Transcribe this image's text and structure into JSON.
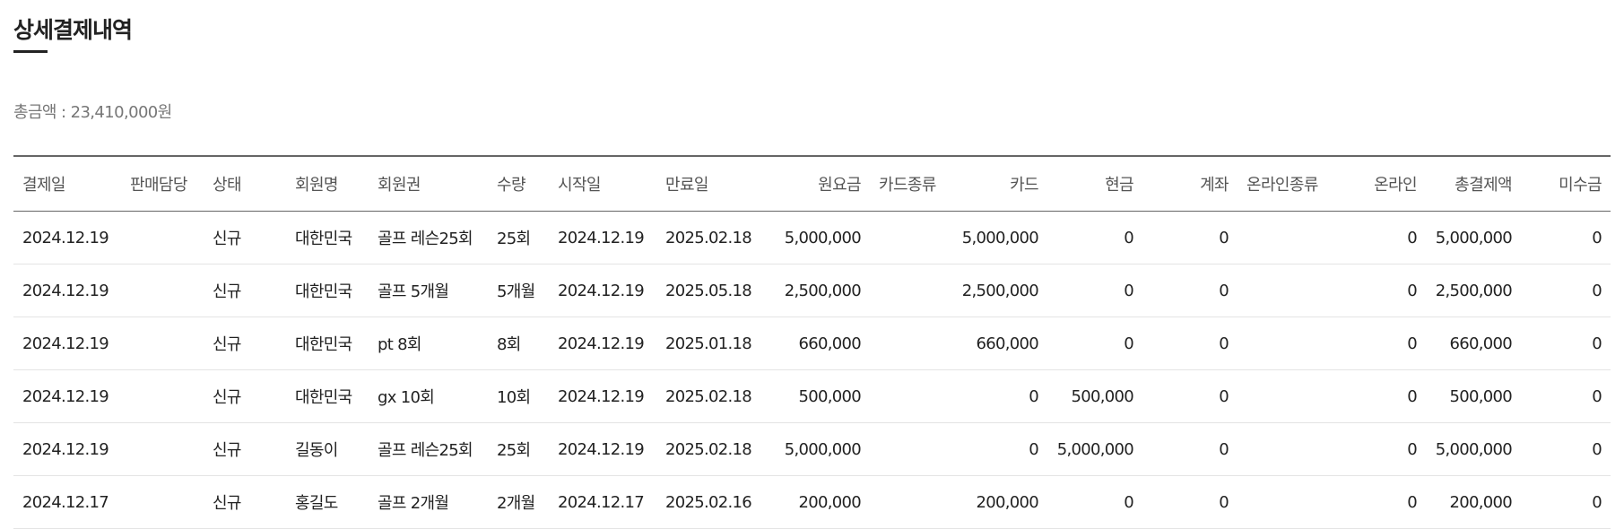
{
  "title": "상세결제내역",
  "total_label": "총금액 : 23,410,000원",
  "columns": [
    {
      "key": "pay_date",
      "label": "결제일"
    },
    {
      "key": "staff",
      "label": "판매담당"
    },
    {
      "key": "status",
      "label": "상태"
    },
    {
      "key": "member",
      "label": "회원명"
    },
    {
      "key": "membership",
      "label": "회원권"
    },
    {
      "key": "qty",
      "label": "수량"
    },
    {
      "key": "start",
      "label": "시작일"
    },
    {
      "key": "end",
      "label": "만료일"
    },
    {
      "key": "base_fee",
      "label": "원요금"
    },
    {
      "key": "card_type",
      "label": "카드종류"
    },
    {
      "key": "card",
      "label": "카드"
    },
    {
      "key": "cash",
      "label": "현금"
    },
    {
      "key": "account",
      "label": "계좌"
    },
    {
      "key": "online_type",
      "label": "온라인종류"
    },
    {
      "key": "online",
      "label": "온라인"
    },
    {
      "key": "total_paid",
      "label": "총결제액"
    },
    {
      "key": "unpaid",
      "label": "미수금"
    }
  ],
  "rows": [
    {
      "pay_date": "2024.12.19",
      "staff": "",
      "status": "신규",
      "member": "대한민국",
      "membership": "골프 레슨25회",
      "qty": "25회",
      "start": "2024.12.19",
      "end": "2025.02.18",
      "base_fee": "5,000,000",
      "card_type": "",
      "card": "5,000,000",
      "cash": "0",
      "account": "0",
      "online_type": "",
      "online": "0",
      "total_paid": "5,000,000",
      "unpaid": "0"
    },
    {
      "pay_date": "2024.12.19",
      "staff": "",
      "status": "신규",
      "member": "대한민국",
      "membership": "골프 5개월",
      "qty": "5개월",
      "start": "2024.12.19",
      "end": "2025.05.18",
      "base_fee": "2,500,000",
      "card_type": "",
      "card": "2,500,000",
      "cash": "0",
      "account": "0",
      "online_type": "",
      "online": "0",
      "total_paid": "2,500,000",
      "unpaid": "0"
    },
    {
      "pay_date": "2024.12.19",
      "staff": "",
      "status": "신규",
      "member": "대한민국",
      "membership": "pt 8회",
      "qty": "8회",
      "start": "2024.12.19",
      "end": "2025.01.18",
      "base_fee": "660,000",
      "card_type": "",
      "card": "660,000",
      "cash": "0",
      "account": "0",
      "online_type": "",
      "online": "0",
      "total_paid": "660,000",
      "unpaid": "0"
    },
    {
      "pay_date": "2024.12.19",
      "staff": "",
      "status": "신규",
      "member": "대한민국",
      "membership": "gx 10회",
      "qty": "10회",
      "start": "2024.12.19",
      "end": "2025.02.18",
      "base_fee": "500,000",
      "card_type": "",
      "card": "0",
      "cash": "500,000",
      "account": "0",
      "online_type": "",
      "online": "0",
      "total_paid": "500,000",
      "unpaid": "0"
    },
    {
      "pay_date": "2024.12.19",
      "staff": "",
      "status": "신규",
      "member": "길동이",
      "membership": "골프 레슨25회",
      "qty": "25회",
      "start": "2024.12.19",
      "end": "2025.02.18",
      "base_fee": "5,000,000",
      "card_type": "",
      "card": "0",
      "cash": "5,000,000",
      "account": "0",
      "online_type": "",
      "online": "0",
      "total_paid": "5,000,000",
      "unpaid": "0"
    },
    {
      "pay_date": "2024.12.17",
      "staff": "",
      "status": "신규",
      "member": "홍길도",
      "membership": "골프 2개월",
      "qty": "2개월",
      "start": "2024.12.17",
      "end": "2025.02.16",
      "base_fee": "200,000",
      "card_type": "",
      "card": "200,000",
      "cash": "0",
      "account": "0",
      "online_type": "",
      "online": "0",
      "total_paid": "200,000",
      "unpaid": "0"
    }
  ]
}
